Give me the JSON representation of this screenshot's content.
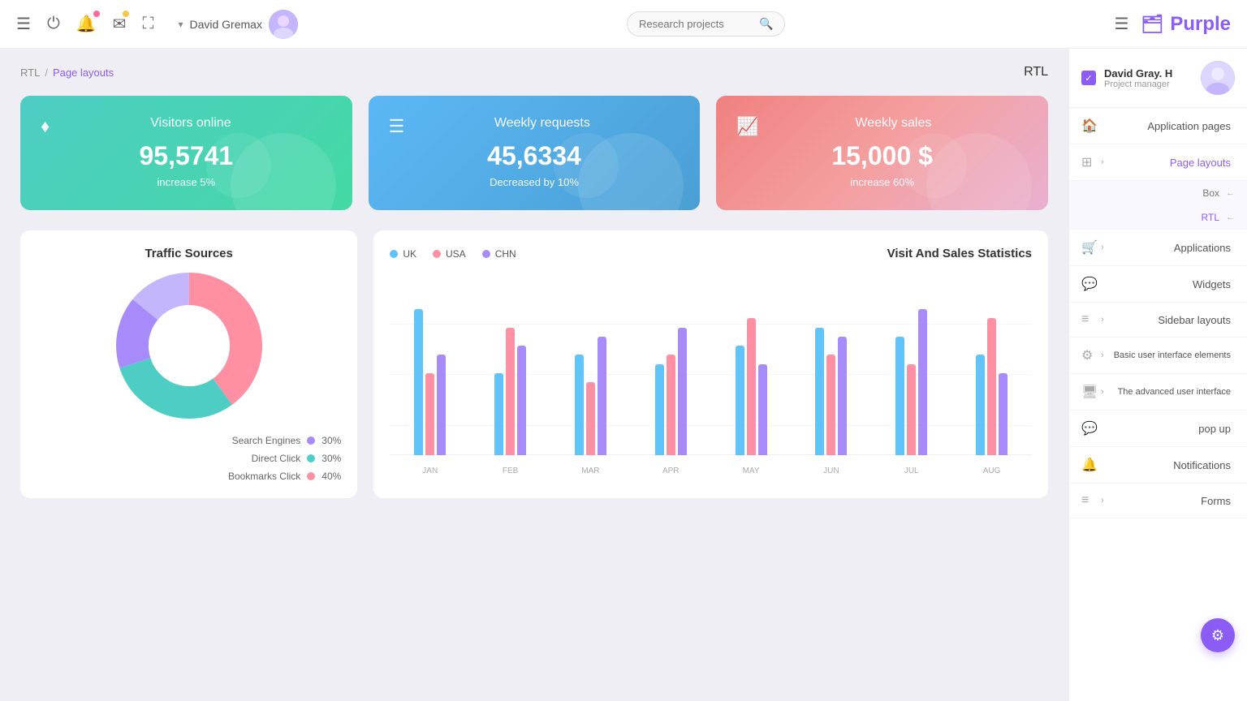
{
  "brand": {
    "name": "Purple",
    "icon": "🗂"
  },
  "navbar": {
    "user_name": "David Gremax",
    "search_placeholder": "Research projects",
    "icons": [
      "menu-lines",
      "power",
      "bell",
      "mail",
      "expand"
    ]
  },
  "breadcrumb": {
    "root": "RTL",
    "separator": "/",
    "current": "Page layouts",
    "rtl_label": "RTL"
  },
  "stat_cards": [
    {
      "icon": "♦",
      "title": "Visitors online",
      "value": "95,5741",
      "change": "increase 5%",
      "color": "green"
    },
    {
      "icon": "☰",
      "title": "Weekly requests",
      "value": "45,6334",
      "change": "Decreased by 10%",
      "color": "blue"
    },
    {
      "icon": "📈",
      "title": "Weekly sales",
      "value": "15,000 $",
      "change": "increase 60%",
      "color": "pink"
    }
  ],
  "traffic_chart": {
    "title": "Traffic Sources",
    "segments": [
      {
        "label": "Search Engines",
        "color": "#a78bfa",
        "percent": "30%",
        "value": 30
      },
      {
        "label": "Direct Click",
        "color": "#4ecdc4",
        "percent": "30%",
        "value": 30
      },
      {
        "label": "Bookmarks Click",
        "color": "#ff8fa3",
        "percent": "40%",
        "value": 40
      }
    ]
  },
  "bar_chart": {
    "title": "Visit And Sales Statistics",
    "legend": [
      {
        "label": "UK",
        "color": "#60c3fa"
      },
      {
        "label": "USA",
        "color": "#ff8fa3"
      },
      {
        "label": "CHN",
        "color": "#a78bfa"
      }
    ],
    "months": [
      {
        "label": "JAN",
        "uk": 80,
        "usa": 45,
        "chn": 55
      },
      {
        "label": "FEB",
        "uk": 45,
        "usa": 70,
        "chn": 60
      },
      {
        "label": "MAR",
        "uk": 55,
        "usa": 40,
        "chn": 65
      },
      {
        "label": "APR",
        "uk": 50,
        "usa": 55,
        "chn": 70
      },
      {
        "label": "MAY",
        "uk": 60,
        "usa": 75,
        "chn": 50
      },
      {
        "label": "JUN",
        "uk": 70,
        "usa": 55,
        "chn": 65
      },
      {
        "label": "JUL",
        "uk": 65,
        "usa": 50,
        "chn": 80
      },
      {
        "label": "AUG",
        "uk": 55,
        "usa": 75,
        "chn": 45
      }
    ]
  },
  "sidebar": {
    "user": {
      "name": "David Gray. H",
      "role": "Project manager"
    },
    "items": [
      {
        "id": "application-pages",
        "label": "Application pages",
        "icon": "🏠",
        "has_chevron": false
      },
      {
        "id": "page-layouts",
        "label": "Page layouts",
        "icon": "⊞",
        "has_chevron": true,
        "active": true,
        "subitems": [
          {
            "label": "Box",
            "active": false
          },
          {
            "label": "RTL",
            "active": true
          }
        ]
      },
      {
        "id": "applications",
        "label": "Applications",
        "icon": "🛒",
        "has_chevron": true
      },
      {
        "id": "widgets",
        "label": "Widgets",
        "icon": "💬",
        "has_chevron": false
      },
      {
        "id": "sidebar-layouts",
        "label": "Sidebar layouts",
        "icon": "≡",
        "has_chevron": true
      },
      {
        "id": "basic-ui",
        "label": "Basic user interface elements",
        "icon": "⚙",
        "has_chevron": true
      },
      {
        "id": "advanced-ui",
        "label": "The advanced user interface",
        "icon": "🖥",
        "has_chevron": true
      },
      {
        "id": "popup",
        "label": "pop up",
        "icon": "💬",
        "has_chevron": false
      },
      {
        "id": "notifications",
        "label": "Notifications",
        "icon": "🔔",
        "has_chevron": false
      },
      {
        "id": "forms",
        "label": "Forms",
        "icon": "≡",
        "has_chevron": true
      }
    ],
    "fab_icon": "⚙"
  }
}
